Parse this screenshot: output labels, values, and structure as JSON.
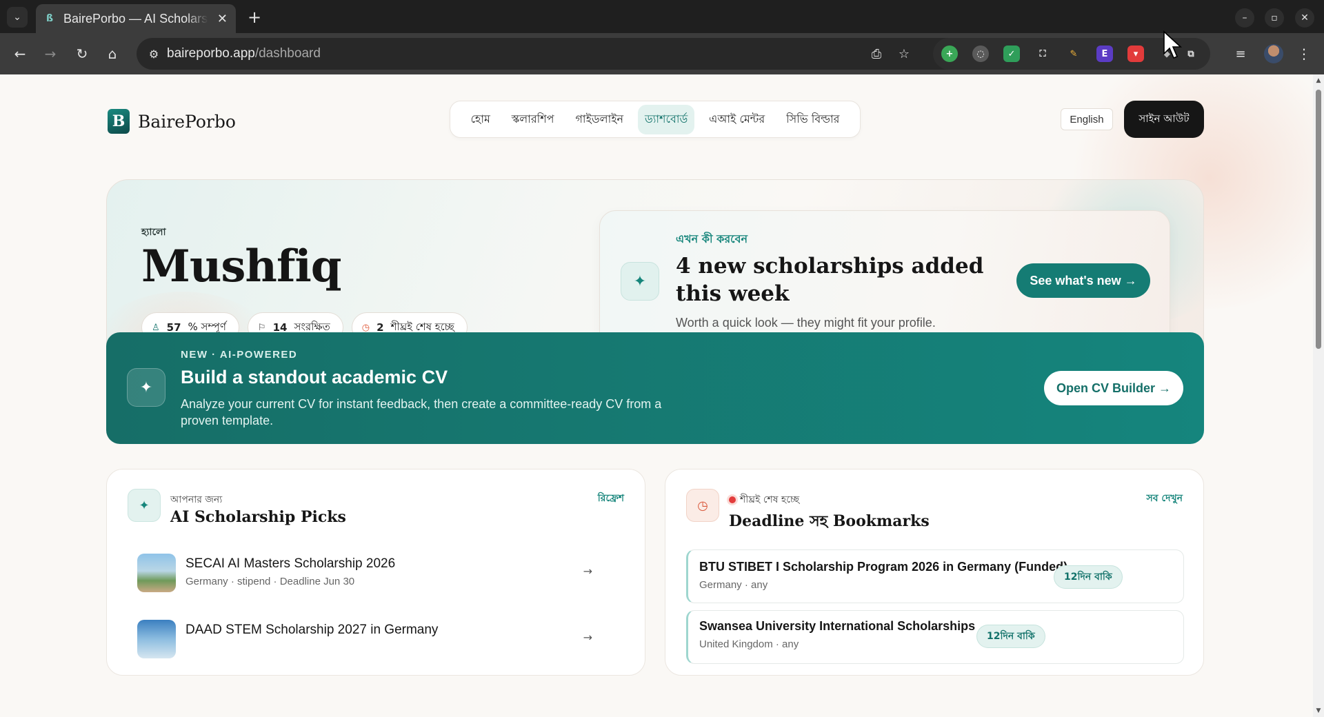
{
  "browser": {
    "tab_title": "BairePorbo — AI Scholarships",
    "tab_close": "✕",
    "new_tab": "+",
    "url_host": "baireporbo.app",
    "url_path": "/dashboard"
  },
  "site": {
    "brand": "BairePorbo",
    "brand_mark": "B",
    "nav": [
      {
        "label": "হোম"
      },
      {
        "label": "স্কলারশিপ"
      },
      {
        "label": "গাইডলাইন"
      },
      {
        "label": "ড্যাশবোর্ড"
      },
      {
        "label": "এআই মেন্টর"
      },
      {
        "label": "সিভি বিল্ডার"
      }
    ],
    "language": "English",
    "signout": "সাইন আউট"
  },
  "hero": {
    "greeting": "হ্যালো",
    "name": "Mushfiq",
    "chips": [
      {
        "value": "57",
        "label": "% সম্পূর্ণ"
      },
      {
        "value": "14",
        "label": "সংরক্ষিত"
      },
      {
        "value": "2",
        "label": "শীঘ্রই শেষ হচ্ছে"
      }
    ],
    "todo": {
      "kicker": "এখন কী করবেন",
      "title": "4 new scholarships added this week",
      "subtitle": "Worth a quick look — they might fit your profile.",
      "button": "See what's new →"
    }
  },
  "cv_banner": {
    "kicker": "NEW · AI-POWERED",
    "title": "Build a standout academic CV",
    "subtitle": "Analyze your current CV for instant feedback, then create a committee-ready CV from a proven template.",
    "button": "Open CV Builder →"
  },
  "picks": {
    "kicker": "আপনার জন্য",
    "title": "AI Scholarship Picks",
    "action": "রিফ্রেশ",
    "items": [
      {
        "title": "SECAI AI Masters Scholarship 2026",
        "meta": "Germany · stipend · Deadline Jun 30"
      },
      {
        "title": "DAAD STEM Scholarship 2027 in Germany",
        "meta": ""
      }
    ]
  },
  "deadlines": {
    "kicker": "শীঘ্রই শেষ হচ্ছে",
    "title": "Deadline সহ Bookmarks",
    "action": "সব দেখুন",
    "items": [
      {
        "title": "BTU STIBET I Scholarship Program 2026 in Germany (Funded)",
        "meta": "Germany · any",
        "badge": "12দিন বাকি"
      },
      {
        "title": "Swansea University International Scholarships",
        "meta": "United Kingdom · any",
        "badge": "12দিন বাকি"
      }
    ]
  },
  "icons": {
    "sparkle": "✦",
    "clock": "◷",
    "arrow": "→"
  },
  "colors": {
    "accent": "#157c74",
    "accent_light": "#e3f2ef",
    "warning": "#e33c3c"
  }
}
